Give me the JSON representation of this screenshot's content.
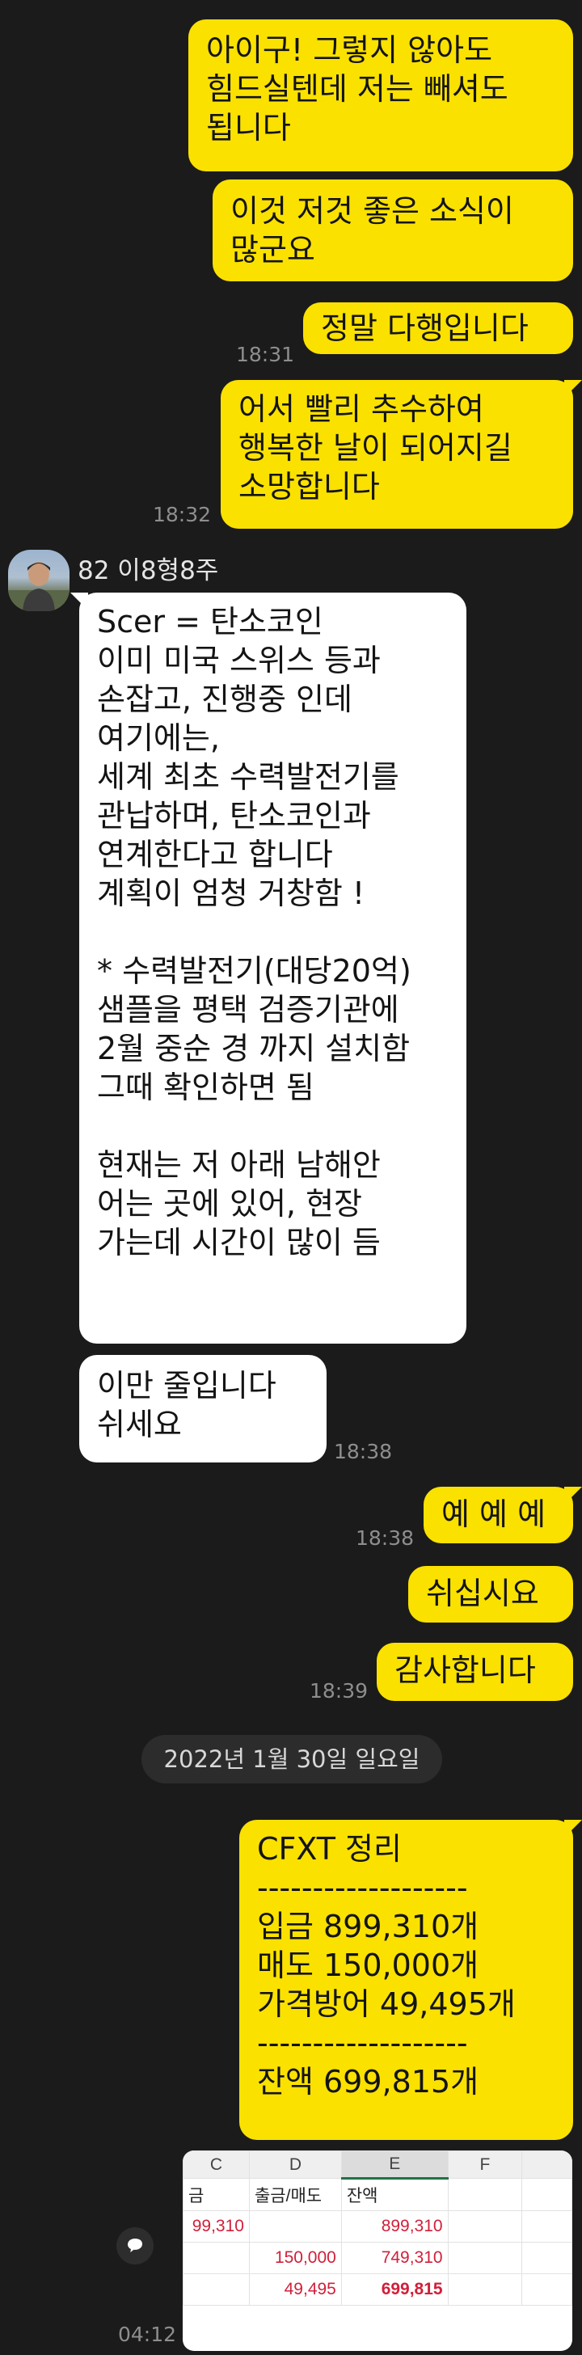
{
  "messages_top": [
    {
      "text": "아이구! 그렇지 않아도\n힘드실텐데 저는 빼셔도\n됩니다",
      "time": ""
    },
    {
      "text": "이것 저것 좋은 소식이\n많군요",
      "time": ""
    },
    {
      "text": "정말 다행입니다",
      "time": "18:31"
    },
    {
      "text": "어서 빨리 추수하여\n행복한 날이 되어지길\n소망합니다",
      "time": "18:32"
    }
  ],
  "sender": {
    "name": "82 이8형8주"
  },
  "messages_them": [
    {
      "text": "Scer = 탄소코인\n이미 미국 스위스 등과\n손잡고, 진행중 인데\n여기에는,\n세계 최초 수력발전기를\n관납하며, 탄소코인과\n연계한다고 합니다\n계획이 엄청 거창함 !\n\n* 수력발전기(대당20억)\n샘플을 평택 검증기관에\n2월 중순 경 까지 설치함\n그때 확인하면 됨\n\n현재는 저 아래 남해안\n어는 곳에 있어, 현장\n가는데 시간이 많이 듬",
      "time": ""
    },
    {
      "text": "이만 줄입니다\n쉬세요",
      "time": "18:38"
    }
  ],
  "messages_mid": [
    {
      "text": "예 예 예",
      "time": "18:38"
    },
    {
      "text": "쉬십시요",
      "time": ""
    },
    {
      "text": "감사합니다",
      "time": "18:39"
    }
  ],
  "date_divider": "2022년 1월 30일 일요일",
  "summary_message": {
    "text": "CFXT 정리\n-------------------\n입금 899,310개\n매도 150,000개\n가격방어  49,495개\n-------------------\n잔액 699,815개"
  },
  "spreadsheet": {
    "columns": [
      "C",
      "D",
      "E",
      "F"
    ],
    "header_row": [
      "금",
      "출금/매도",
      "잔액",
      ""
    ],
    "rows": [
      [
        "99,310",
        "",
        "899,310",
        ""
      ],
      [
        "",
        "150,000",
        "749,310",
        ""
      ],
      [
        "",
        "49,495",
        "699,815",
        ""
      ]
    ],
    "time": "04:12"
  },
  "icons": {
    "share": "speech-bubble-icon"
  },
  "colors": {
    "my_bubble": "#fae100",
    "their_bubble": "#ffffff",
    "background": "#1b1b1b"
  }
}
